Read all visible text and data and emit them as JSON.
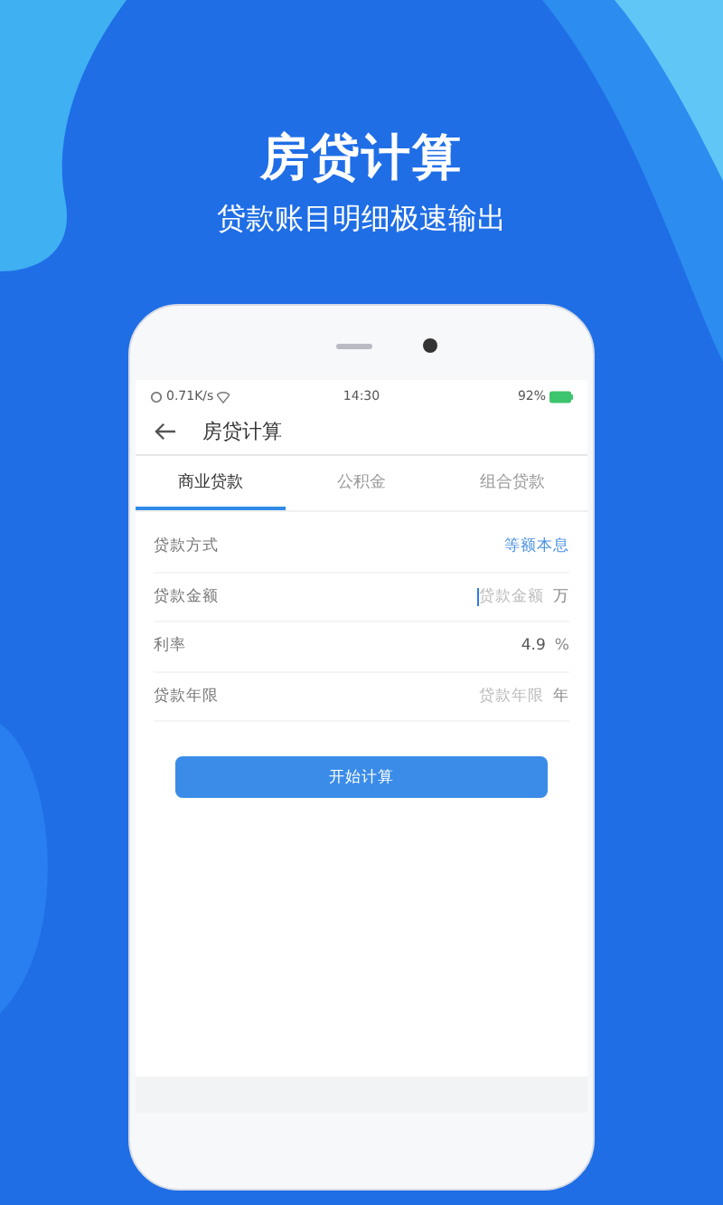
{
  "promo": {
    "title": "房贷计算",
    "subtitle": "贷款账目明细极速输出"
  },
  "status_bar": {
    "network_speed": "0.71K/s",
    "time": "14:30",
    "battery": "92%"
  },
  "app_bar": {
    "title": "房贷计算"
  },
  "tabs": [
    {
      "label": "商业贷款",
      "selected": true
    },
    {
      "label": "公积金",
      "selected": false
    },
    {
      "label": "组合贷款",
      "selected": false
    }
  ],
  "form_rows": [
    {
      "kind": "select",
      "label": "贷款方式",
      "value": "等额本息"
    },
    {
      "kind": "input",
      "label": "贷款金额",
      "placeholder": "贷款金额",
      "unit": "万",
      "focused": true
    },
    {
      "kind": "input",
      "label": "利率",
      "value": "4.9",
      "unit": "%",
      "focused": false
    },
    {
      "kind": "input",
      "label": "贷款年限",
      "placeholder": "贷款年限",
      "unit": "年",
      "focused": false
    }
  ],
  "submit_button": {
    "label": "开始计算"
  }
}
